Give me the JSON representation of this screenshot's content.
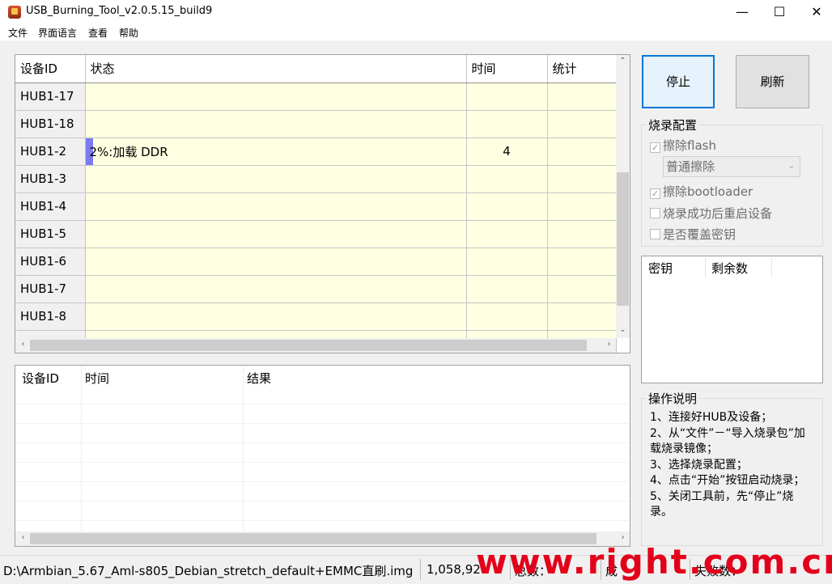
{
  "window": {
    "title": "USB_Burning_Tool_v2.0.5.15_build9",
    "minimize": "—",
    "maximize": "☐",
    "close": "✕"
  },
  "menu": [
    "文件",
    "界面语言",
    "查看",
    "帮助"
  ],
  "grid": {
    "headers": [
      "设备ID",
      "状态",
      "时间",
      "统计"
    ],
    "rows": [
      {
        "id": "HUB1-17",
        "status": "",
        "time": "",
        "stat": ""
      },
      {
        "id": "HUB1-18",
        "status": "",
        "time": "",
        "stat": ""
      },
      {
        "id": "HUB1-2",
        "status": "2%:加载 DDR",
        "time": "4",
        "stat": "",
        "progress": 0.02
      },
      {
        "id": "HUB1-3",
        "status": "",
        "time": "",
        "stat": ""
      },
      {
        "id": "HUB1-4",
        "status": "",
        "time": "",
        "stat": ""
      },
      {
        "id": "HUB1-5",
        "status": "",
        "time": "",
        "stat": ""
      },
      {
        "id": "HUB1-6",
        "status": "",
        "time": "",
        "stat": ""
      },
      {
        "id": "HUB1-7",
        "status": "",
        "time": "",
        "stat": ""
      },
      {
        "id": "HUB1-8",
        "status": "",
        "time": "",
        "stat": ""
      },
      {
        "id": "",
        "status": "",
        "time": "",
        "stat": ""
      }
    ]
  },
  "log": {
    "headers": [
      "设备ID",
      "时间",
      "结果"
    ]
  },
  "buttons": {
    "stop": "停止",
    "refresh": "刷新"
  },
  "config": {
    "title": "烧录配置",
    "erase_flash": "擦除flash",
    "erase_mode": "普通擦除",
    "erase_bootloader": "擦除bootloader",
    "reboot_after": "烧录成功后重启设备",
    "overwrite_key": "是否覆盖密钥"
  },
  "keys": {
    "headers": [
      "密钥",
      "剩余数"
    ]
  },
  "help": {
    "title": "操作说明",
    "lines": [
      "1、连接好HUB及设备；",
      "2、从“文件”－“导入烧录包”加载烧录镜像；",
      "3、选择烧录配置；",
      "4、点击“开始”按钮启动烧录；",
      "5、关闭工具前，先“停止”烧录。"
    ]
  },
  "status": {
    "image_path": "D:\\Armbian_5.67_Aml-s805_Debian_stretch_default+EMMC直刷.img",
    "size": "1,058,92",
    "seg3": "总数：",
    "seg4": "成",
    "seg5": "失败数：",
    "watermark": "www.right.com.cn"
  },
  "colors": {
    "grid_cell": "#ffffe1",
    "progress": "#7b7bef",
    "accent": "#0078d7",
    "watermark": "#e3001b"
  }
}
